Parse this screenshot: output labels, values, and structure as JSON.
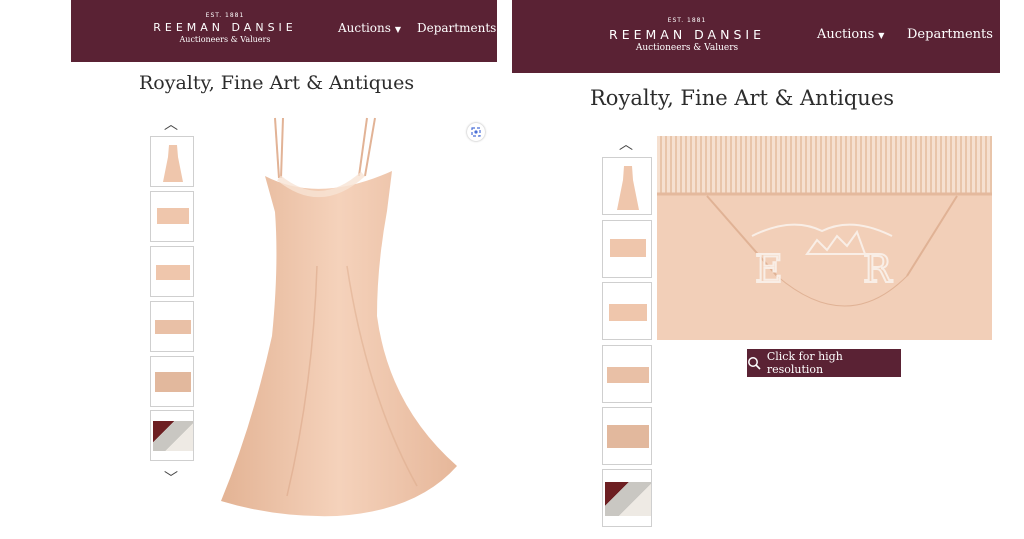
{
  "header": {
    "est": "EST. 1881",
    "brand_name": "REEMAN DANSIE",
    "tagline": "Auctioneers & Valuers",
    "nav": [
      {
        "label": "Auctions"
      },
      {
        "label": "Departments"
      }
    ]
  },
  "page_title": "Royalty, Fine Art & Antiques",
  "hires_button": {
    "label": "Click for high resolution"
  },
  "icons": {
    "prev": "chevron-up-icon",
    "next": "chevron-down-icon",
    "zoom": "zoom-icon",
    "search": "search-icon"
  },
  "colors": {
    "header_bg": "#5a2234",
    "garment": "#efc6ac"
  }
}
